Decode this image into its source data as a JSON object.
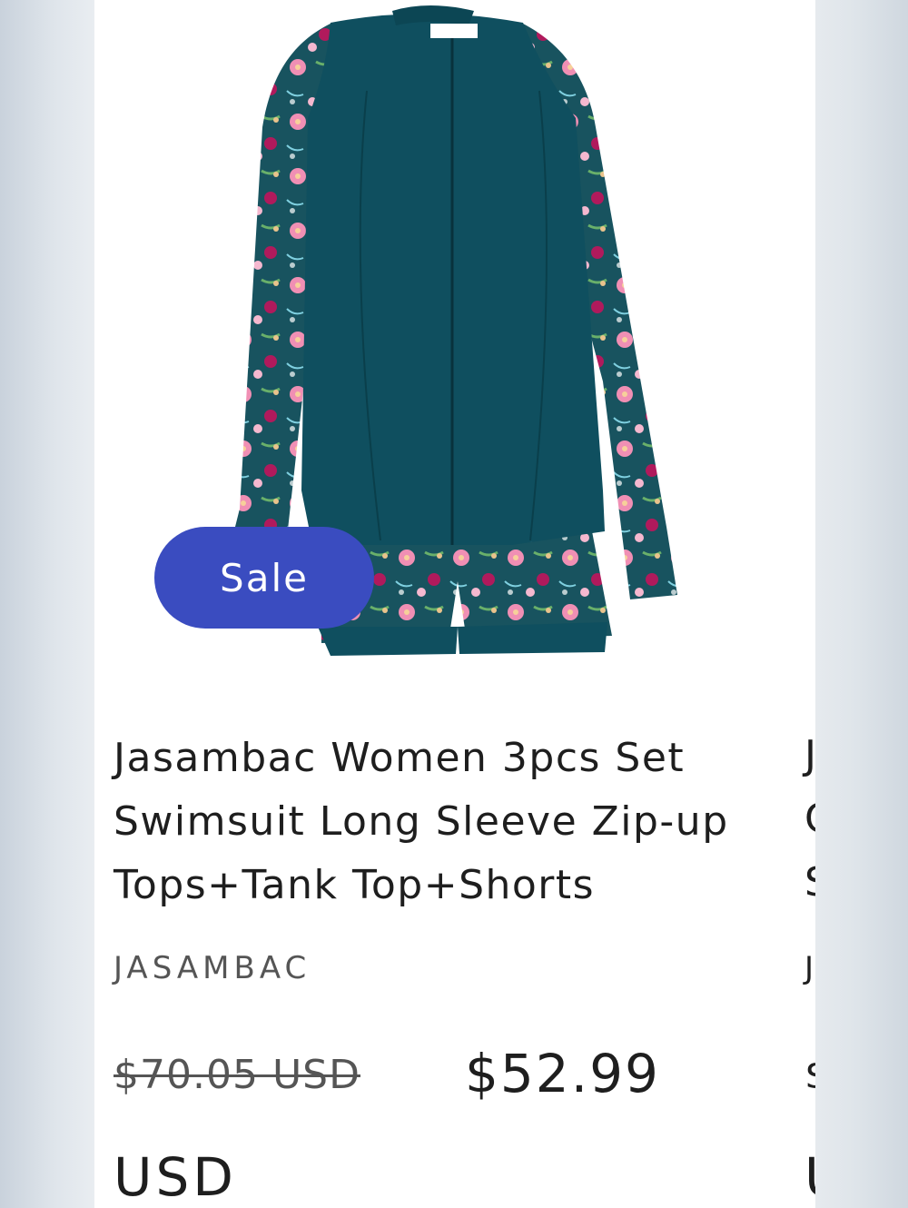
{
  "product": {
    "badge": "Sale",
    "title_lines": [
      "Jasambac Women 3pcs Set",
      "Swimsuit Long Sleeve Zip-up",
      "Tops+Tank Top+Shorts"
    ],
    "brand": "JASAMBAC",
    "regular_price": "$70.05 USD",
    "sale_price": "$52.99",
    "sale_currency": "USD",
    "label_tag": "Jasambac"
  },
  "next_card_peek": [
    "J",
    "C",
    "S",
    "J",
    "$",
    "U"
  ],
  "colors": {
    "badge": "#3a4cc0",
    "swimsuit": "#0f4f5f",
    "text": "#1e1e1e",
    "muted_text": "#555555"
  }
}
